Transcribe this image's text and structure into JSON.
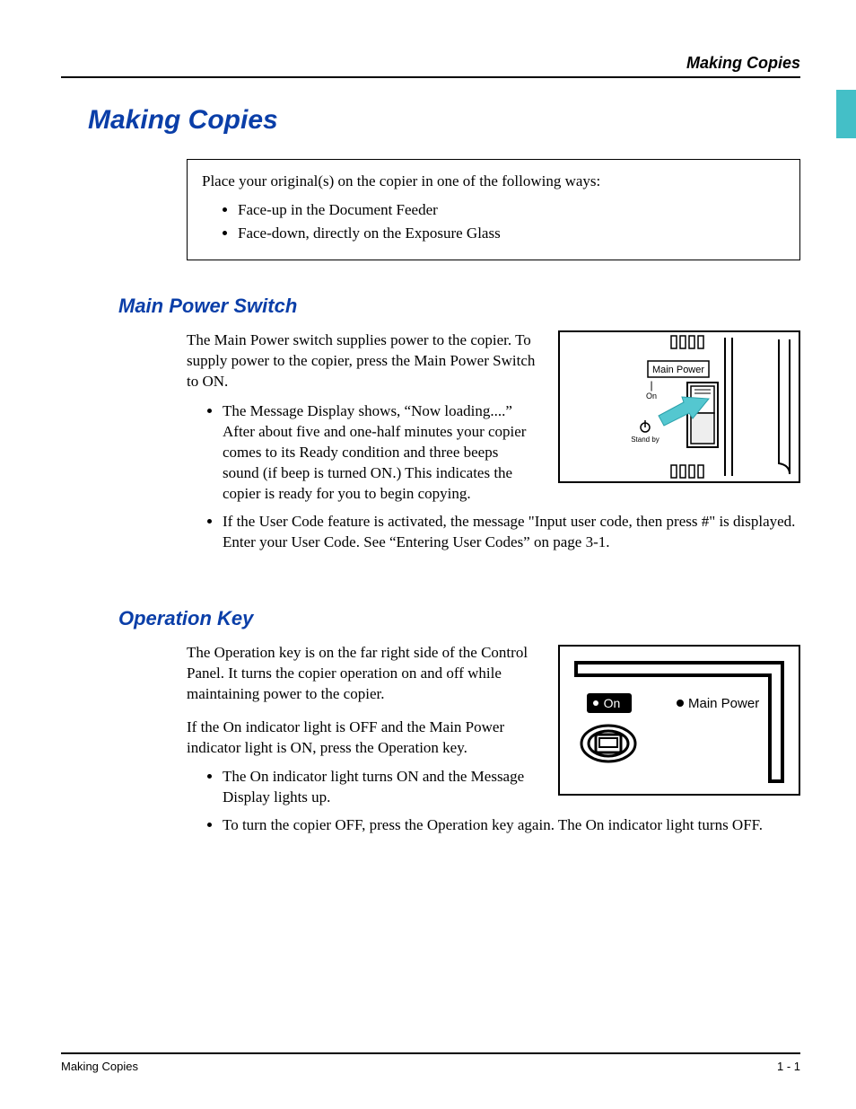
{
  "header": {
    "running_head": "Making Copies"
  },
  "chapter": {
    "title": "Making Copies"
  },
  "intro": {
    "lead": "Place your original(s) on the copier in one of the following ways:",
    "items": [
      "Face-up in the Document Feeder",
      "Face-down, directly on the Exposure Glass"
    ]
  },
  "sections": [
    {
      "title": "Main Power Switch",
      "para1": "The Main Power switch supplies power to the copier. To supply power to the copier, press the Main Power Switch to ON.",
      "bullets": [
        "The Message Display shows, “Now loading....” After about five and one-half minutes your copier comes to its Ready condition and three beeps sound (if beep is turned ON.) This indicates the copier is ready for you to begin copying.",
        "If the User Code feature is activated, the message \"Input user code, then press #\" is displayed. Enter your User Code. See “Entering User Codes” on page 3-1."
      ],
      "figure": {
        "label_main_power": "Main Power",
        "label_on": "On",
        "label_standby": "Stand by"
      }
    },
    {
      "title": "Operation Key",
      "para1": "The Operation key is on the far right side of the Control Panel. It turns the copier operation on and off while maintaining power to the copier.",
      "para2": "If the On indicator light is OFF and the Main Power indicator light is ON, press the Operation key.",
      "bullets": [
        "The On indicator light turns ON and the Message Display lights up.",
        "To turn the copier OFF, press the Operation key again. The On indicator light turns OFF."
      ],
      "figure": {
        "label_on": "On",
        "label_main_power": "Main Power"
      }
    }
  ],
  "footer": {
    "left": "Making Copies",
    "right": "1 - 1"
  }
}
